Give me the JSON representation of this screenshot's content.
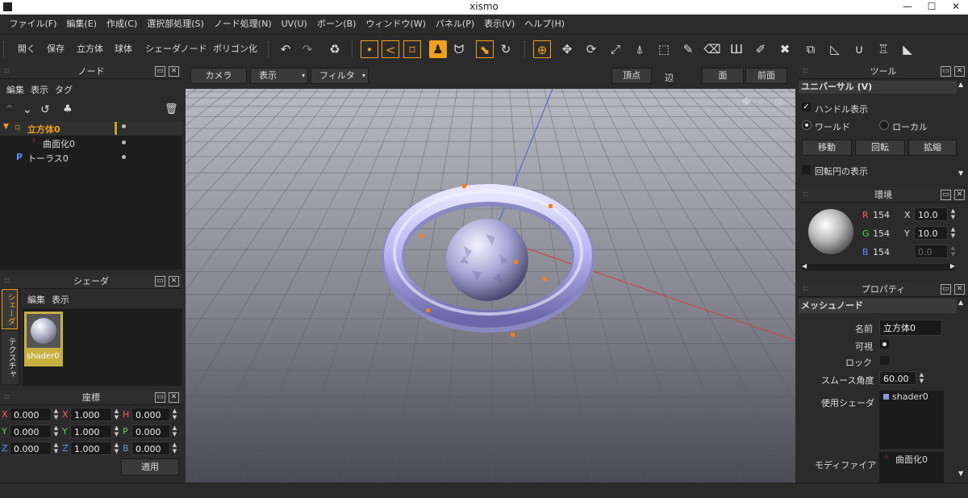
{
  "window": {
    "title": "xismo"
  },
  "menu": [
    "ファイル(F)",
    "編集(E)",
    "作成(C)",
    "選択部処理(S)",
    "ノード処理(N)",
    "UV(U)",
    "ボーン(B)",
    "ウィンドウ(W)",
    "パネル(P)",
    "表示(V)",
    "ヘルプ(H)"
  ],
  "toolbar": {
    "open": "開く",
    "save": "保存",
    "cube": "立方体",
    "sphere": "球体",
    "shader_node": "シェーダノード",
    "polygonize": "ポリゴン化"
  },
  "node_panel": {
    "title": "ノード",
    "menu": [
      "編集",
      "表示",
      "タグ"
    ],
    "tree": [
      {
        "label": "立方体0",
        "icon": "cube-node-icon"
      },
      {
        "label": "曲面化0",
        "icon": "subdivide-icon"
      },
      {
        "label": "トーラス0",
        "icon": "torus-node-icon"
      }
    ]
  },
  "shader_panel": {
    "title": "シェーダ",
    "menu": [
      "編集",
      "表示"
    ],
    "shader_name": "shader0",
    "side_tabs": [
      "シェーダ",
      "テクスチャ"
    ]
  },
  "coord_panel": {
    "title": "座標",
    "rows": [
      {
        "a": "X",
        "av": "0.000",
        "b": "X",
        "bv": "1.000",
        "c": "H",
        "cv": "0.000"
      },
      {
        "a": "Y",
        "av": "0.000",
        "b": "Y",
        "bv": "1.000",
        "c": "P",
        "cv": "0.000"
      },
      {
        "a": "Z",
        "av": "0.000",
        "b": "Z",
        "bv": "1.000",
        "c": "B",
        "cv": "0.000"
      }
    ],
    "apply": "適用"
  },
  "viewport": {
    "camera": "カメラ",
    "display": "表示",
    "filter": "フィルタ",
    "vertex": "頂点",
    "edge": "辺",
    "face": "面",
    "front": "前面"
  },
  "tool_panel": {
    "title": "ツール",
    "mode": "ユニバーサル (V)",
    "show_handle": "ハンドル表示",
    "world": "ワールド",
    "local": "ローカル",
    "move": "移動",
    "rotate": "回転",
    "scale": "拡縮",
    "show_rot_circle": "回転円の表示"
  },
  "env_panel": {
    "title": "環境",
    "r": "154",
    "g": "154",
    "b": "154",
    "x": "10.0",
    "y": "10.0",
    "z": "0.0",
    "r_label": "R",
    "g_label": "G",
    "b_label": "B",
    "x_label": "X",
    "y_label": "Y",
    "colors": {
      "r": "#ff5a5a",
      "g": "#56d456",
      "b": "#6a8cff"
    }
  },
  "prop_panel": {
    "title": "プロパティ",
    "section": "メッシュノード",
    "name_label": "名前",
    "name": "立方体0",
    "visible_label": "可視",
    "lock_label": "ロック",
    "smooth_label": "スムース角度",
    "smooth": "60.00",
    "shader_label": "使用シェーダ",
    "shader": "shader0",
    "modifier_label": "モディファイア",
    "modifier": "曲面化0"
  },
  "colors": {
    "accent": "#f0a020",
    "selected_text": "#f0a020"
  }
}
